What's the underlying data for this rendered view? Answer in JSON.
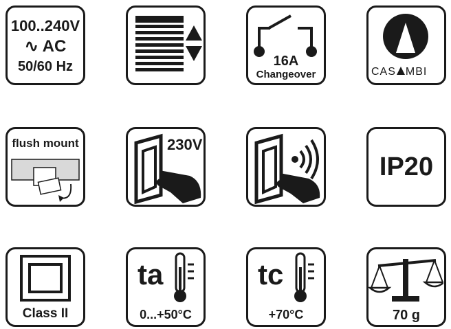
{
  "icons": {
    "power": {
      "line1": "100..240V",
      "line2": "AC",
      "line2_symbol": "∿",
      "line3": "50/60 Hz"
    },
    "blinds": {
      "icon": "blinds-up-down-icon"
    },
    "relay": {
      "rating": "16A",
      "type": "Changeover"
    },
    "casambi": {
      "brand_left": "CAS",
      "brand_right": "MBI"
    },
    "flush_mount": {
      "label": "flush mount"
    },
    "switch_230v": {
      "label": "230V"
    },
    "wireless_switch": {
      "icon": "wireless-switch-icon"
    },
    "ip_rating": {
      "label": "IP20"
    },
    "class_ii": {
      "label": "Class II"
    },
    "ambient_temp": {
      "prefix": "ta",
      "range": "0...+50°C"
    },
    "case_temp": {
      "prefix": "tc",
      "value": "+70°C"
    },
    "weight": {
      "value": "70 g"
    }
  },
  "colors": {
    "stroke": "#1a1a1a",
    "box_fill": "#d9d9d9",
    "background": "#ffffff"
  }
}
